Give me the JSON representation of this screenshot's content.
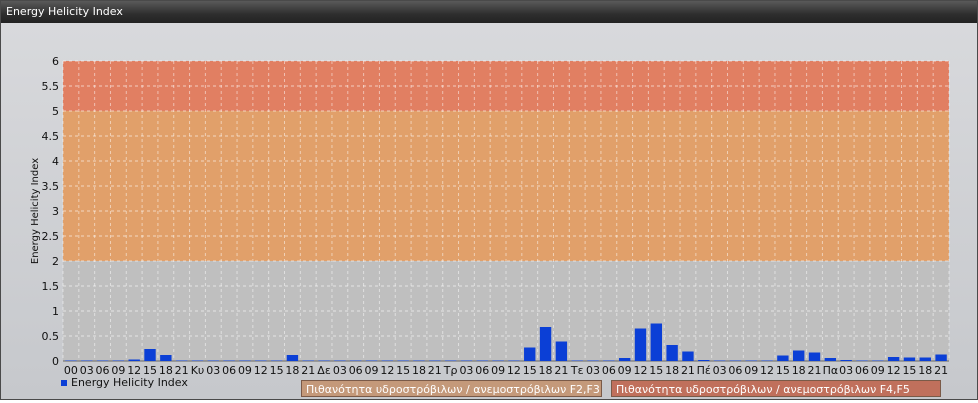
{
  "window": {
    "title": "Energy Helicity Index"
  },
  "colors": {
    "bar": "#0b3fd6",
    "band_low": "#bfbfbf",
    "band_mid": "#e1a06a",
    "band_high": "#e17f62",
    "grid": "#ffffff"
  },
  "chart_data": {
    "type": "bar",
    "ylabel": "Energy Helicity Index",
    "xlabel": "",
    "ylim": [
      0,
      6
    ],
    "yticks": [
      "0",
      "0.5",
      "1",
      "1.5",
      "2",
      "2.5",
      "3",
      "3.5",
      "4",
      "4.5",
      "5",
      "5.5",
      "6"
    ],
    "bands": [
      {
        "from": 0,
        "to": 2,
        "color": "#bfbfbf"
      },
      {
        "from": 2,
        "to": 5,
        "color": "#e1a06a"
      },
      {
        "from": 5,
        "to": 6,
        "color": "#e17f62"
      }
    ],
    "categories": [
      "00",
      "03",
      "06",
      "09",
      "12",
      "15",
      "18",
      "21",
      "Κυ",
      "03",
      "06",
      "09",
      "12",
      "15",
      "18",
      "21",
      "Δε",
      "03",
      "06",
      "09",
      "12",
      "15",
      "18",
      "21",
      "Τρ",
      "03",
      "06",
      "09",
      "12",
      "15",
      "18",
      "21",
      "Τε",
      "03",
      "06",
      "09",
      "12",
      "15",
      "18",
      "21",
      "Πέ",
      "03",
      "06",
      "09",
      "12",
      "15",
      "18",
      "21",
      "Πα",
      "03",
      "06",
      "09",
      "12",
      "15",
      "18",
      "21"
    ],
    "series": [
      {
        "name": "Energy Helicity Index",
        "values": [
          0.01,
          0.01,
          0.01,
          0.01,
          0.03,
          0.24,
          0.12,
          0.01,
          0.01,
          0.01,
          0.01,
          0.01,
          0.01,
          0.01,
          0.12,
          0.01,
          0.01,
          0.01,
          0.01,
          0.01,
          0.01,
          0.01,
          0.01,
          0.01,
          0.01,
          0.01,
          0.01,
          0.01,
          0.01,
          0.27,
          0.68,
          0.39,
          0.01,
          0.01,
          0.01,
          0.06,
          0.65,
          0.75,
          0.32,
          0.19,
          0.02,
          0.01,
          0.01,
          0.01,
          0.01,
          0.11,
          0.21,
          0.17,
          0.06,
          0.02,
          0.01,
          0.01,
          0.08,
          0.07,
          0.07,
          0.13
        ]
      }
    ]
  },
  "legend": {
    "series_label": "Energy Helicity Index"
  },
  "band_legend": {
    "f2f3": "Πιθανότητα υδροστρόβιλων / ανεμοστρόβιλων F2,F3",
    "f4f5": "Πιθανότητα υδροστρόβιλων / ανεμοστρόβιλων F4,F5"
  }
}
